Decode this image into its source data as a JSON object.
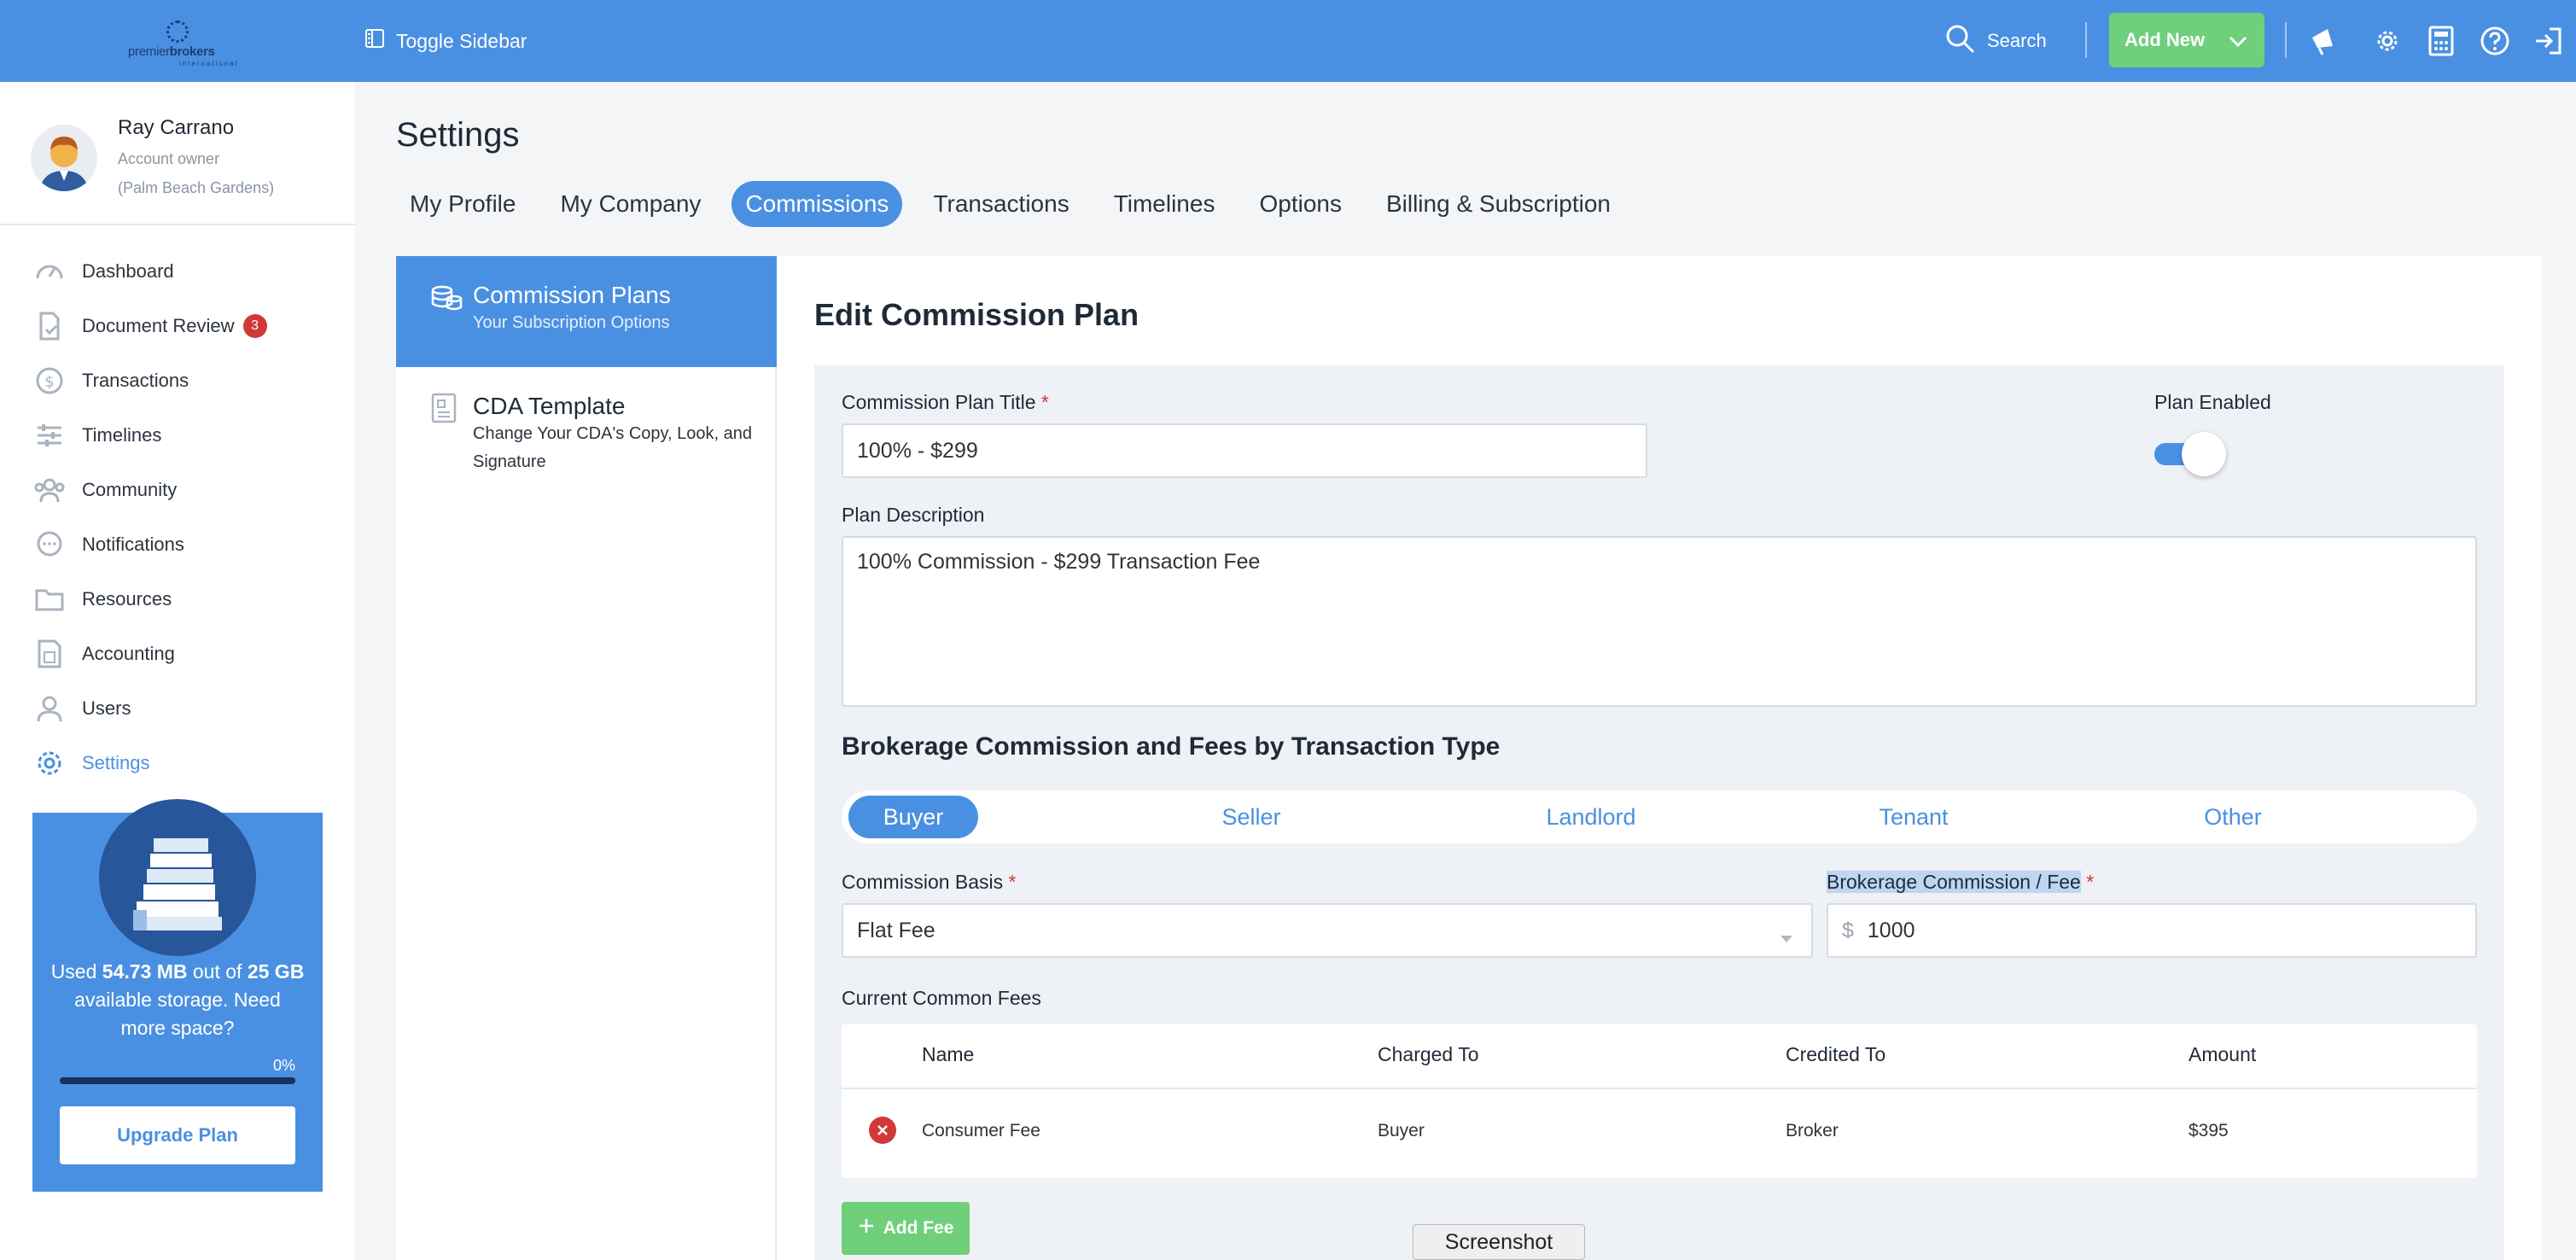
{
  "topbar": {
    "logo_word_a": "premier",
    "logo_word_b": "brokers",
    "logo_sub": "international",
    "toggle_label": "Toggle Sidebar",
    "search_label": "Search",
    "add_new_label": "Add New",
    "brand_color": "#4a90e2"
  },
  "profile": {
    "name": "Ray Carrano",
    "role": "Account owner",
    "location": "(Palm Beach Gardens)"
  },
  "nav": {
    "items": [
      {
        "label": "Dashboard",
        "icon": "dashboard-gauge-icon"
      },
      {
        "label": "Document Review",
        "icon": "document-check-icon",
        "badge": "3"
      },
      {
        "label": "Transactions",
        "icon": "dollar-circle-icon"
      },
      {
        "label": "Timelines",
        "icon": "timeline-sliders-icon"
      },
      {
        "label": "Community",
        "icon": "community-people-icon"
      },
      {
        "label": "Notifications",
        "icon": "chat-bubble-icon"
      },
      {
        "label": "Resources",
        "icon": "folder-icon"
      },
      {
        "label": "Accounting",
        "icon": "accounting-icon"
      },
      {
        "label": "Users",
        "icon": "user-icon"
      },
      {
        "label": "Settings",
        "icon": "gear-icon",
        "active": true
      }
    ]
  },
  "storage": {
    "prefix": "Used ",
    "used": "54.73 MB",
    "mid": " out of ",
    "total": "25 GB",
    "suffix": " available storage. Need more space?",
    "percent_label": "0%",
    "percent_value": 0,
    "upgrade_label": "Upgrade Plan"
  },
  "page": {
    "title": "Settings",
    "tabs": [
      {
        "label": "My Profile"
      },
      {
        "label": "My Company"
      },
      {
        "label": "Commissions",
        "active": true
      },
      {
        "label": "Transactions"
      },
      {
        "label": "Timelines"
      },
      {
        "label": "Options"
      },
      {
        "label": "Billing & Subscription"
      }
    ]
  },
  "subnav": {
    "items": [
      {
        "title": "Commission Plans",
        "desc": "Your Subscription Options",
        "active": true
      },
      {
        "title": "CDA Template",
        "desc": "Change Your CDA's Copy, Look, and Signature"
      }
    ]
  },
  "editor": {
    "title": "Edit Commission Plan",
    "plan_title_label": "Commission Plan Title",
    "plan_title_value": "100% - $299",
    "plan_enabled_label": "Plan Enabled",
    "plan_enabled": true,
    "plan_desc_label": "Plan Description",
    "plan_desc_value": "100% Commission - $299 Transaction Fee",
    "section_title": "Brokerage Commission and Fees by Transaction Type",
    "transaction_types": [
      "Buyer",
      "Seller",
      "Landlord",
      "Tenant",
      "Other"
    ],
    "active_type": "Buyer",
    "basis_label": "Commission Basis",
    "basis_value": "Flat Fee",
    "fee_label": "Brokerage Commission / Fee",
    "fee_currency": "$",
    "fee_value": "1000",
    "common_fees_label": "Current Common Fees",
    "fee_columns": [
      "Name",
      "Charged To",
      "Credited To",
      "Amount"
    ],
    "fee_rows": [
      {
        "name": "Consumer Fee",
        "charged_to": "Buyer",
        "credited_to": "Broker",
        "amount": "$395"
      }
    ],
    "add_fee_label": "Add Fee"
  },
  "tooltip": {
    "label": "Screenshot"
  }
}
